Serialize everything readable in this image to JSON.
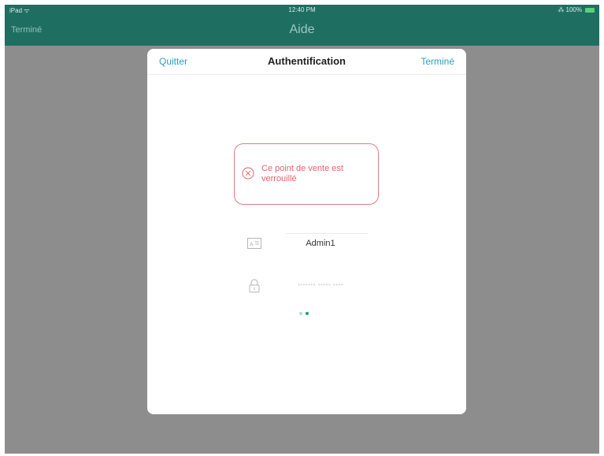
{
  "statusbar": {
    "carrier": "iPad ᯤ",
    "time": "12:40 PM",
    "battery": "⁂ 100%"
  },
  "navbar": {
    "left_button": "Terminé",
    "title": "Aide"
  },
  "modal": {
    "quit_label": "Quitter",
    "title": "Authentification",
    "done_label": "Terminé"
  },
  "alert": {
    "icon": "close-circle-icon",
    "text": "Ce point de vente est verrouillé"
  },
  "form": {
    "username_value": "Admin1",
    "password_placeholder": "••••••• ••••• ••••"
  },
  "pager": {
    "active_index": 2,
    "count": 2
  },
  "colors": {
    "accent": "#2aa0b6",
    "navbar": "#1f6e62",
    "alert": "#e3656c"
  }
}
